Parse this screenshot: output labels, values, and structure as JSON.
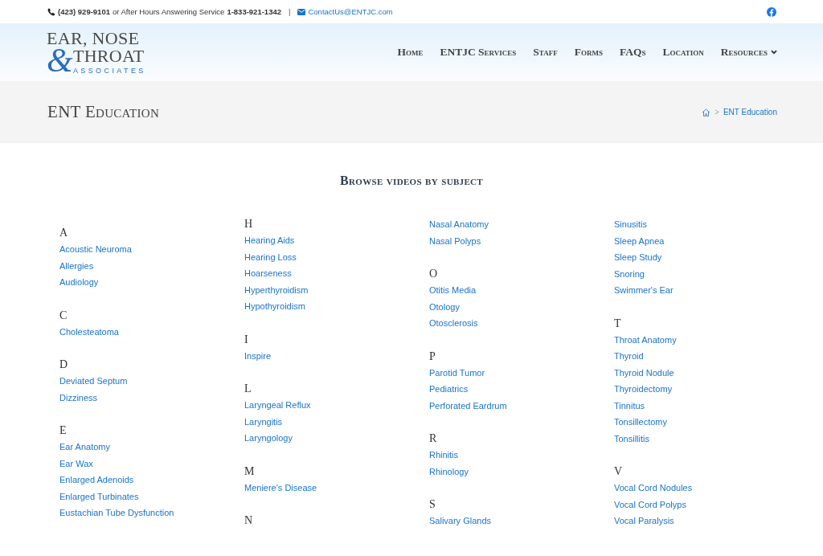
{
  "topbar": {
    "phone": "(423) 929-9101",
    "after_hours_label": "or After Hours Answering Service",
    "after_hours_phone": "1-833-921-1342",
    "separator": "|",
    "email": "ContactUs@ENTJC.com"
  },
  "logo": {
    "line_1": "EAR, NOSE",
    "ampersand": "&",
    "line_2": "THROAT",
    "line_3": "ASSOCIATES"
  },
  "nav": [
    {
      "label": "Home",
      "dropdown": false
    },
    {
      "label": "ENTJC Services",
      "dropdown": false
    },
    {
      "label": "Staff",
      "dropdown": false
    },
    {
      "label": "Forms",
      "dropdown": false
    },
    {
      "label": "FAQs",
      "dropdown": false
    },
    {
      "label": "Location",
      "dropdown": false
    },
    {
      "label": "Resources",
      "dropdown": true
    }
  ],
  "page_header": {
    "title": "ENT Education",
    "breadcrumb_separator": ">",
    "breadcrumb_current": "ENT Education"
  },
  "heading": "Browse videos by subject",
  "columns": [
    [
      {
        "letter": "A",
        "items": [
          "Acoustic Neuroma",
          "Allergies",
          "Audiology"
        ]
      },
      {
        "letter": "C",
        "items": [
          "Cholesteatoma"
        ]
      },
      {
        "letter": "D",
        "items": [
          "Deviated Septum",
          "Dizziness"
        ]
      },
      {
        "letter": "E",
        "items": [
          "Ear Anatomy",
          "Ear Wax",
          "Enlarged Adenoids",
          "Enlarged Turbinates",
          "Eustachian Tube Dysfunction"
        ]
      }
    ],
    [
      {
        "letter": "H",
        "items": [
          "Hearing Aids",
          "Hearing Loss",
          "Hoarseness",
          "Hyperthyroidism",
          "Hypothyroidism"
        ]
      },
      {
        "letter": "I",
        "items": [
          "Inspire"
        ]
      },
      {
        "letter": "L",
        "items": [
          "Laryngeal Reflux",
          "Laryngitis",
          "Laryngology"
        ]
      },
      {
        "letter": "M",
        "items": [
          "Meniere's Disease"
        ]
      },
      {
        "letter": "N"
      }
    ],
    [
      {
        "items": [
          "Nasal Anatomy",
          "Nasal Polyps"
        ]
      },
      {
        "letter": "O",
        "items": [
          "Otitis Media",
          "Otology",
          "Otosclerosis"
        ]
      },
      {
        "letter": "P",
        "items": [
          "Parotid Tumor",
          "Pediatrics",
          "Perforated Eardrum"
        ]
      },
      {
        "letter": "R",
        "items": [
          "Rhinitis",
          "Rhinology"
        ]
      },
      {
        "letter": "S",
        "items": [
          "Salivary Glands"
        ]
      }
    ],
    [
      {
        "items": [
          "Sinusitis",
          "Sleep Apnea",
          "Sleep Study",
          "Snoring",
          "Swimmer's Ear"
        ]
      },
      {
        "letter": "T",
        "items": [
          "Throat Anatomy",
          "Thyroid",
          "Thyroid Nodule",
          "Thyroidectomy",
          "Tinnitus",
          "Tonsillectomy",
          "Tonsillitis"
        ]
      },
      {
        "letter": "V",
        "items": [
          "Vocal Cord Nodules",
          "Vocal Cord Polyps",
          "Vocal Paralysis"
        ]
      }
    ]
  ]
}
